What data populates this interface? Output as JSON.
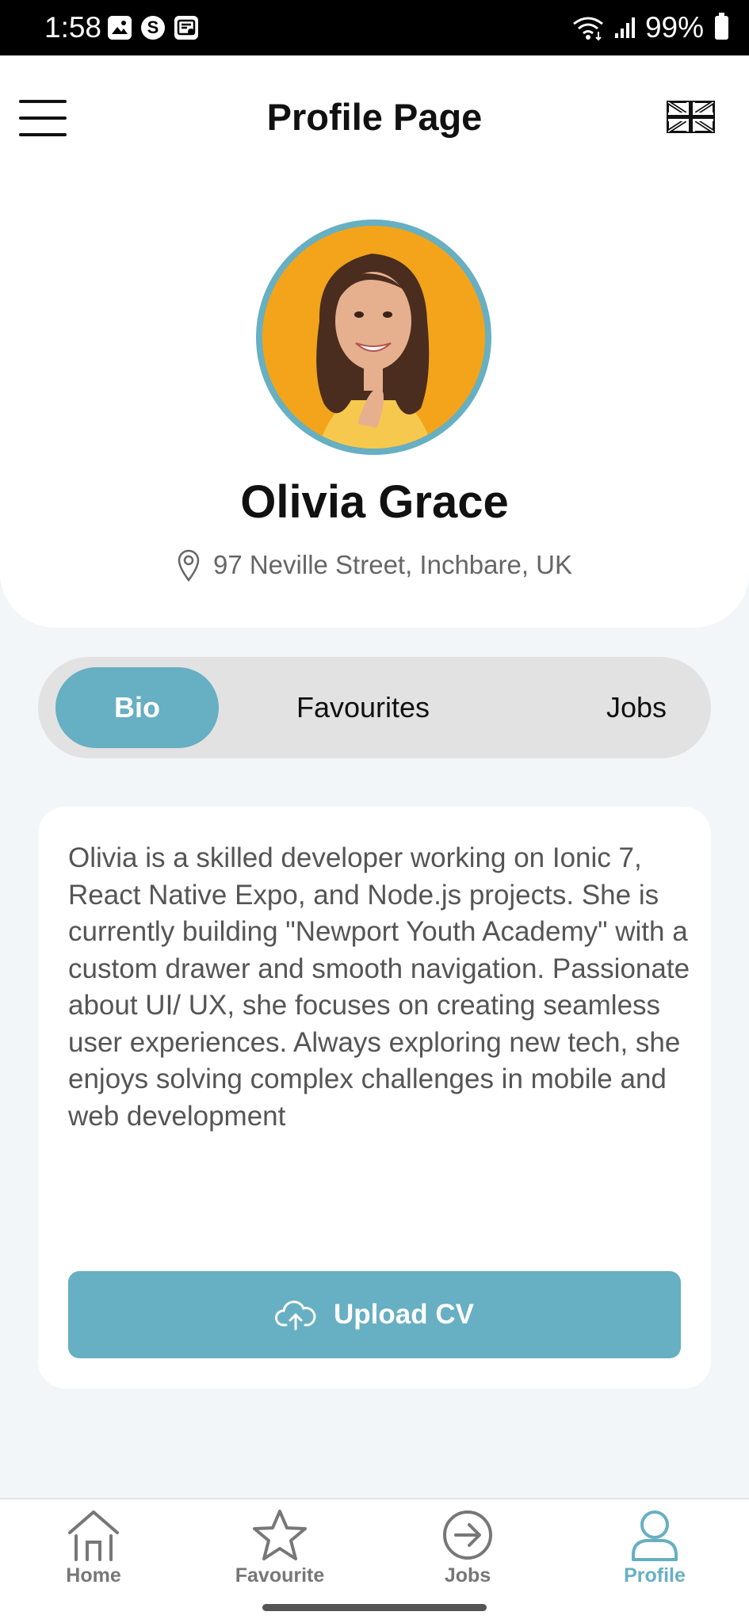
{
  "status_bar": {
    "time": "1:58",
    "battery": "99%",
    "icons_left": [
      "image-icon",
      "skype-icon",
      "wallet-icon"
    ],
    "skype_letter": "S",
    "icons_right": [
      "wifi-icon",
      "signal-icon",
      "battery-icon"
    ]
  },
  "header": {
    "title": "Profile Page",
    "menu_icon": "hamburger-menu-icon",
    "language_icon": "uk-flag-icon"
  },
  "profile": {
    "name": "Olivia Grace",
    "address": "97 Neville Street, Inchbare, UK",
    "location_icon": "map-pin-icon"
  },
  "tabs": [
    {
      "label": "Bio",
      "active": true
    },
    {
      "label": "Favourites",
      "active": false
    },
    {
      "label": "Jobs",
      "active": false
    }
  ],
  "bio": {
    "text": "Olivia is a skilled developer working on Ionic 7, React Native Expo, and Node.js projects. She is currently building \"Newport Youth Academy\" with a custom drawer and smooth navigation. Passionate about UI/ UX, she focuses on creating seamless user experiences. Always exploring new tech, she enjoys solving complex challenges in mobile and web development",
    "upload_label": "Upload CV",
    "upload_icon": "cloud-upload-icon"
  },
  "bottom_nav": [
    {
      "label": "Home",
      "icon": "home-icon",
      "active": false
    },
    {
      "label": "Favourite",
      "icon": "star-icon",
      "active": false
    },
    {
      "label": "Jobs",
      "icon": "arrow-circle-icon",
      "active": false
    },
    {
      "label": "Profile",
      "icon": "user-icon",
      "active": true
    }
  ],
  "colors": {
    "accent": "#67afc2",
    "background": "#f3f6f9",
    "tab_track": "#e2e2e2",
    "inactive_nav": "#777777"
  }
}
